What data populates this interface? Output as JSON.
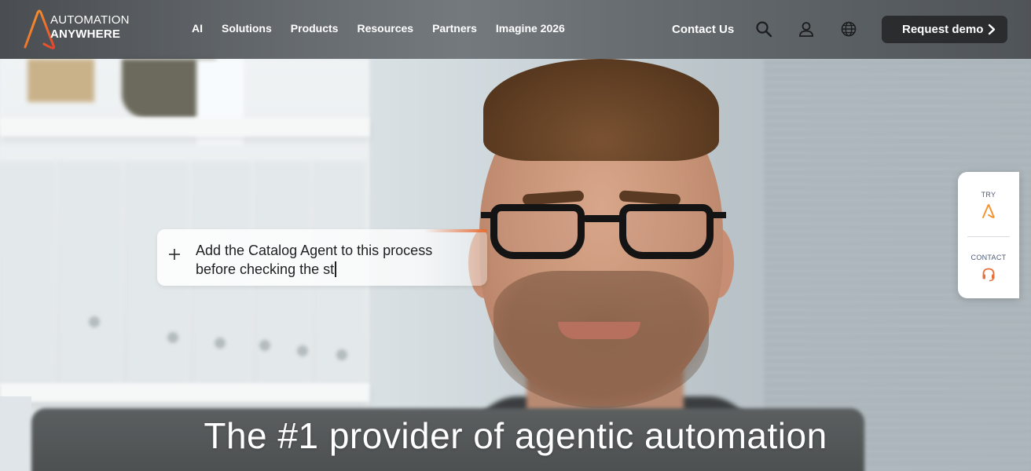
{
  "brand": {
    "line1": "AUTOMATION",
    "line2": "ANYWHERE",
    "accent": "#f59331",
    "accent_red": "#e6432c"
  },
  "nav": {
    "items": [
      "AI",
      "Solutions",
      "Products",
      "Resources",
      "Partners",
      "Imagine 2026"
    ]
  },
  "header": {
    "contact_label": "Contact Us",
    "demo_label": "Request demo",
    "icons": [
      "search-icon",
      "user-icon",
      "globe-icon",
      "chevron-right-icon"
    ]
  },
  "prompt": {
    "text": "Add the Catalog Agent to this process before checking the st",
    "icon": "plus-icon"
  },
  "side_widget": {
    "try_label": "TRY",
    "contact_label": "CONTACT",
    "icons": [
      "automation-anywhere-icon",
      "headset-icon"
    ]
  },
  "hero": {
    "headline": "The #1 provider of agentic automation"
  }
}
